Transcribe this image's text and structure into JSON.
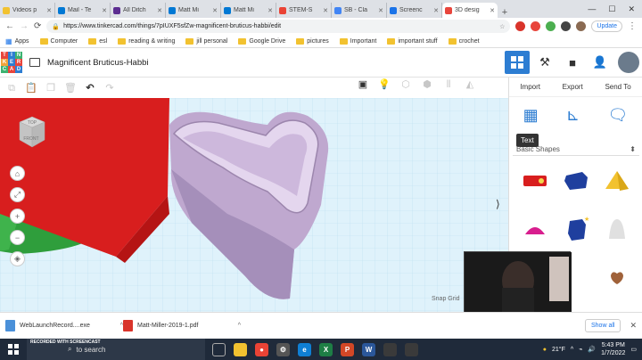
{
  "browser": {
    "tabs": [
      {
        "title": "Videos p",
        "color": "#f2c230",
        "active": false
      },
      {
        "title": "Mail - Te",
        "color": "#0078d4",
        "active": false
      },
      {
        "title": "All Ditch",
        "color": "#5c2d91",
        "active": false
      },
      {
        "title": "Matt Mi",
        "color": "#0078d4",
        "active": false
      },
      {
        "title": "Matt Mi",
        "color": "#0078d4",
        "active": false
      },
      {
        "title": "STEM-S",
        "color": "#ea4335",
        "active": false
      },
      {
        "title": "SB - Cla",
        "color": "#4285f4",
        "active": false
      },
      {
        "title": "Screenc",
        "color": "#1a73e8",
        "active": false
      },
      {
        "title": "3D desig",
        "color": "#e8453c",
        "active": true
      }
    ],
    "new_tab": "+",
    "url": "https://www.tinkercad.com/things/7pIUXF5sfZw-magnificent-bruticus-habbi/edit",
    "update_label": "Update",
    "bookmarks": [
      "Apps",
      "Computer",
      "esl",
      "reading & writing",
      "jill personal",
      "Google Drive",
      "pictures",
      "Important",
      "important stuff",
      "crochet"
    ]
  },
  "tinkercad": {
    "logo_letters": [
      "T",
      "I",
      "N",
      "K",
      "E",
      "R",
      "C",
      "A",
      "D"
    ],
    "logo_colors": [
      "#e8453c",
      "#2d7dd2",
      "#3cb371",
      "#f2a33a",
      "#2d7dd2",
      "#e8453c",
      "#3cb371",
      "#e8453c",
      "#2d7dd2"
    ],
    "design_name": "Magnificent Bruticus-Habbi",
    "panel": {
      "import": "Import",
      "export": "Export",
      "send_to": "Send To",
      "tooltip": "Text",
      "category": "Basic Shapes"
    },
    "viewcube": {
      "top": "TOP",
      "front": "FRONT"
    },
    "snap_grid": "Snap Grid"
  },
  "downloads": {
    "items": [
      {
        "name": "WebLaunchRecord....exe",
        "color": "#4a90d9"
      },
      {
        "name": "Matt-Miller-2019-1.pdf",
        "color": "#d9342b"
      }
    ],
    "show_all": "Show all"
  },
  "taskbar": {
    "recording_label": "RECORDED WITH SCREENCAST",
    "search_placeholder": "to search",
    "weather": "21°F",
    "time": "5:43 PM",
    "date": "1/7/2022"
  }
}
